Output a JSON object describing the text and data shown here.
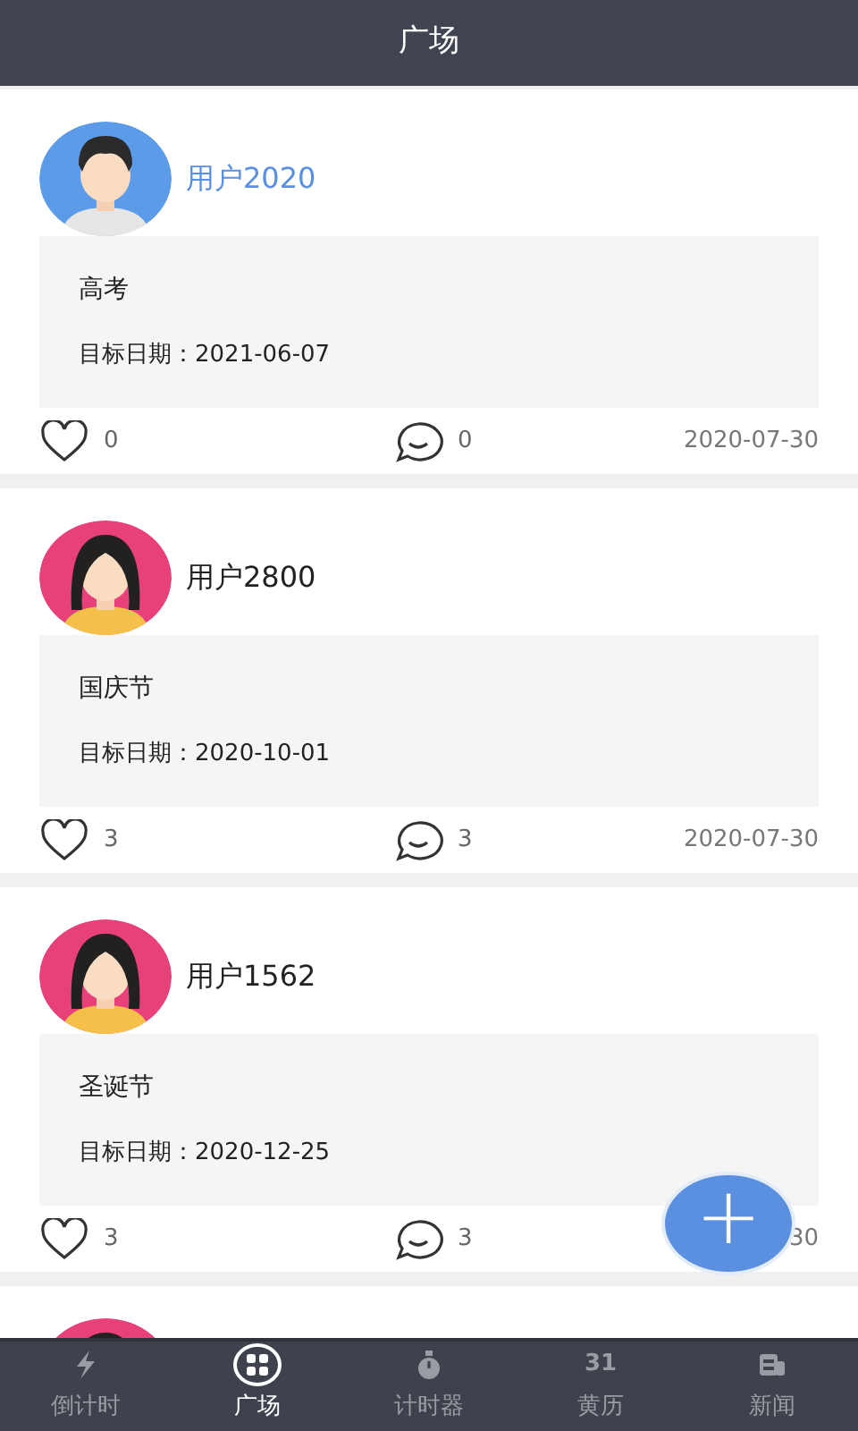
{
  "header": {
    "title": "广场"
  },
  "posts": [
    {
      "kind": "male",
      "user": "用户2020",
      "highlighted": true,
      "event": "高考",
      "target": "目标日期：2021-06-07",
      "likes": "0",
      "comments": "0",
      "date": "2020-07-30"
    },
    {
      "kind": "female",
      "user": "用户2800",
      "highlighted": false,
      "event": "国庆节",
      "target": "目标日期：2020-10-01",
      "likes": "3",
      "comments": "3",
      "date": "2020-07-30"
    },
    {
      "kind": "female",
      "user": "用户1562",
      "highlighted": false,
      "event": "圣诞节",
      "target": "目标日期：2020-12-25",
      "likes": "3",
      "comments": "3",
      "date": "30"
    },
    {
      "kind": "female"
    }
  ],
  "fab": {
    "label": "+"
  },
  "tabs": [
    {
      "kind": "bolt",
      "label": "倒计时",
      "selected": false
    },
    {
      "kind": "grid",
      "label": "广场",
      "selected": true
    },
    {
      "kind": "stopwatch",
      "label": "计时器",
      "selected": false
    },
    {
      "kind": "number",
      "icon_text": "31",
      "label": "黄历",
      "selected": false
    },
    {
      "kind": "news",
      "label": "新闻",
      "selected": false
    }
  ]
}
